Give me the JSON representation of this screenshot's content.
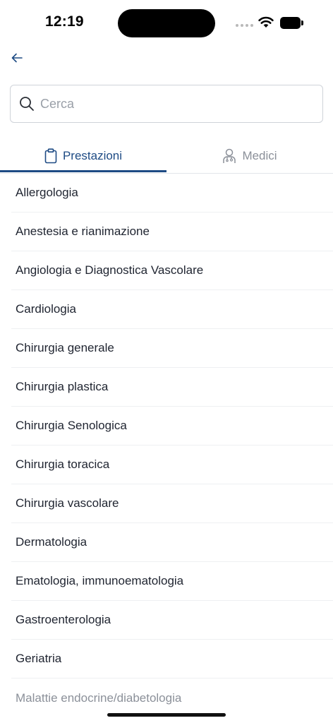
{
  "status_bar": {
    "time": "12:19"
  },
  "search": {
    "placeholder": "Cerca",
    "value": ""
  },
  "tabs": [
    {
      "label": "Prestazioni",
      "icon": "clipboard-icon",
      "active": true
    },
    {
      "label": "Medici",
      "icon": "doctor-icon",
      "active": false
    }
  ],
  "list": {
    "items": [
      "Allergologia",
      "Anestesia e rianimazione",
      "Angiologia e Diagnostica Vascolare",
      "Cardiologia",
      "Chirurgia generale",
      "Chirurgia plastica",
      "Chirurgia Senologica",
      "Chirurgia toracica",
      "Chirurgia vascolare",
      "Dermatologia",
      "Ematologia, immunoematologia",
      "Gastroenterologia",
      "Geriatria",
      "Malattie endocrine/diabetologia"
    ]
  },
  "colors": {
    "accent": "#1e4b84",
    "text": "#1f2430",
    "muted": "#8b9099",
    "divider": "#eef0f2"
  }
}
